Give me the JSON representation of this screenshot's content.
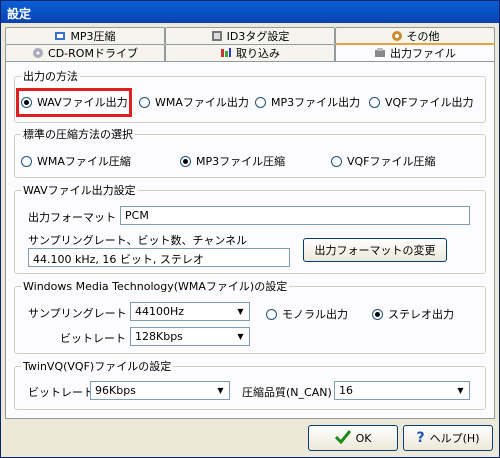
{
  "window": {
    "title": "設定"
  },
  "tabs_top": [
    {
      "label": "MP3圧縮"
    },
    {
      "label": "ID3タグ設定"
    },
    {
      "label": "その他"
    }
  ],
  "tabs_bottom": [
    {
      "label": "CD-ROMドライブ"
    },
    {
      "label": "取り込み"
    },
    {
      "label": "出力ファイル"
    }
  ],
  "output_method": {
    "legend": "出力の方法",
    "options": [
      {
        "label": "WAVファイル出力",
        "selected": true
      },
      {
        "label": "WMAファイル出力",
        "selected": false
      },
      {
        "label": "MP3ファイル出力",
        "selected": false
      },
      {
        "label": "VQFファイル出力",
        "selected": false
      }
    ]
  },
  "compression": {
    "legend": "標準の圧縮方法の選択",
    "options": [
      {
        "label": "WMAファイル圧縮",
        "selected": false
      },
      {
        "label": "MP3ファイル圧縮",
        "selected": true
      },
      {
        "label": "VQFファイル圧縮",
        "selected": false
      }
    ]
  },
  "wav_settings": {
    "legend": "WAVファイル出力設定",
    "format_label": "出力フォーマット",
    "format_value": "PCM",
    "details_label": "サンプリングレート、ビット数、チャンネル",
    "details_value": "44.100 kHz, 16 ビット, ステレオ",
    "change_button": "出力フォーマットの変更"
  },
  "wma_settings": {
    "legend": "Windows Media Technology(WMAファイル)の設定",
    "sampling_label": "サンプリングレート",
    "sampling_value": "44100Hz",
    "bitrate_label": "ビットレート",
    "bitrate_value": "128Kbps",
    "mono_label": "モノラル出力",
    "stereo_label": "ステレオ出力",
    "stereo_selected": true
  },
  "vqf_settings": {
    "legend": "TwinVQ(VQF)ファイルの設定",
    "bitrate_label": "ビットレート",
    "bitrate_value": "96Kbps",
    "quality_label": "圧縮品質(N_CAN)",
    "quality_value": "16"
  },
  "buttons": {
    "ok": "OK",
    "help": "ヘルプ(H)"
  },
  "colors": {
    "highlight": "#e0201e",
    "ok_check": "#1e8a1e",
    "help_icon": "#1f4fb8"
  }
}
